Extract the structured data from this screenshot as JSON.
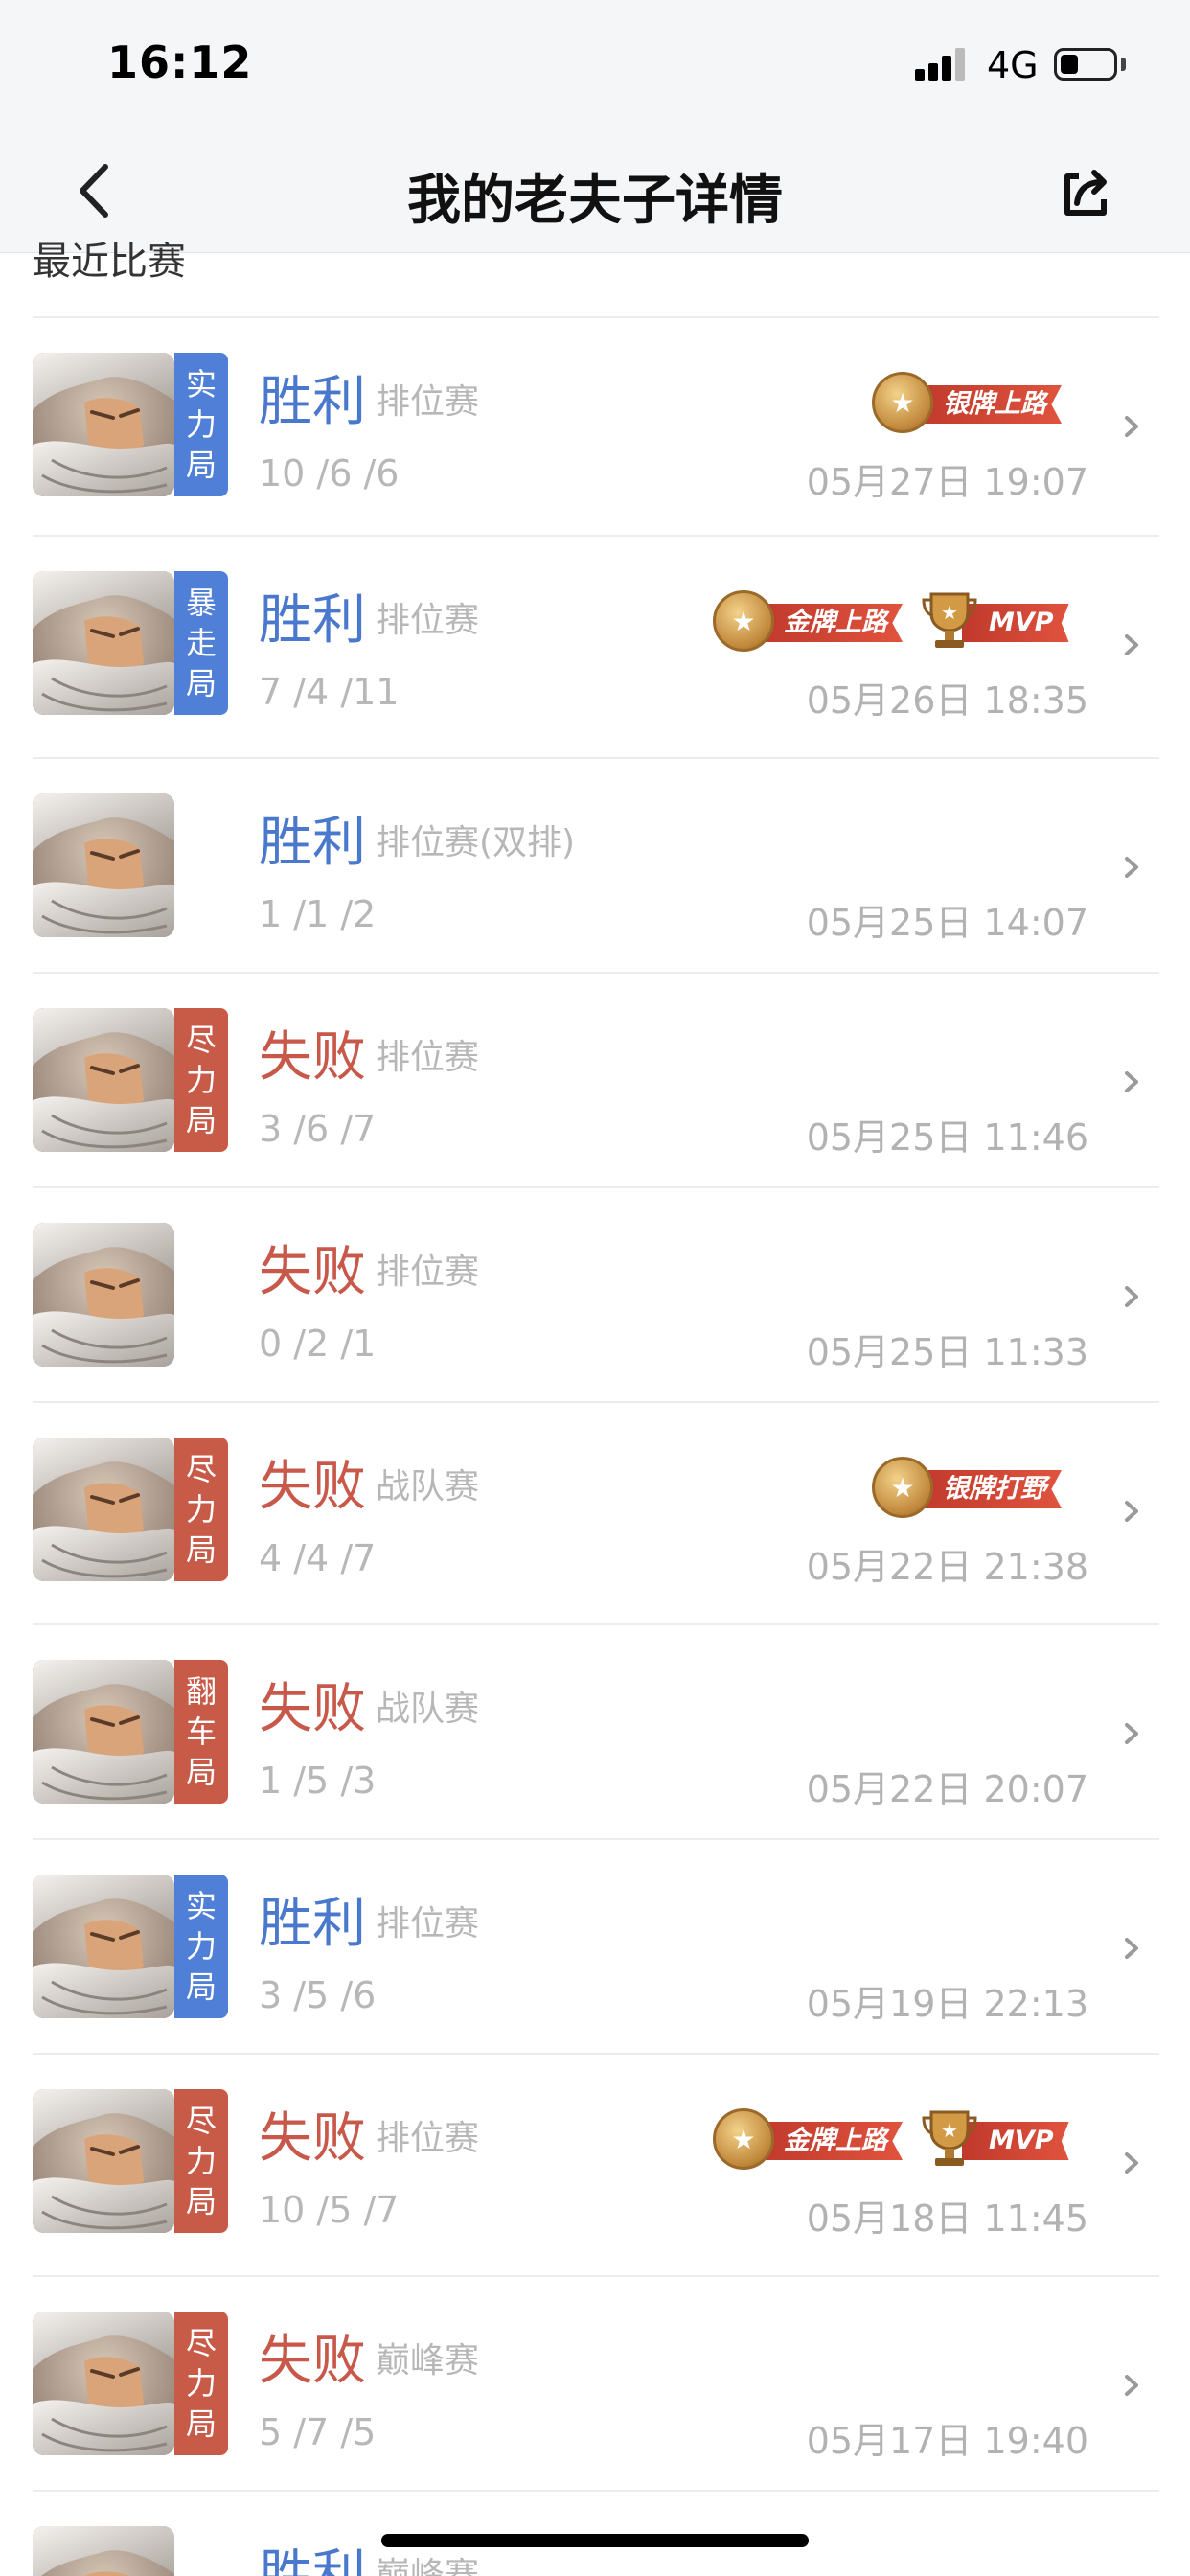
{
  "status_bar": {
    "time": "16:12",
    "network": "4G"
  },
  "nav": {
    "title": "我的老夫子详情"
  },
  "section": {
    "title": "最近比赛"
  },
  "colors": {
    "win": "#4a78cc",
    "lose": "#c8584a",
    "tag_blue": "#4f7fd6",
    "tag_red": "#c85a48",
    "muted": "#b7b7b7"
  },
  "matches": [
    {
      "tag": [
        "实",
        "力",
        "局"
      ],
      "tag_color": "blue",
      "result": "胜利",
      "outcome": "win",
      "mode": "排位赛",
      "kda": "10 /6 /6",
      "date": "05月27日 19:07",
      "badges": [
        {
          "type": "medal",
          "label": "银牌上路"
        }
      ]
    },
    {
      "tag": [
        "暴",
        "走",
        "局"
      ],
      "tag_color": "blue",
      "result": "胜利",
      "outcome": "win",
      "mode": "排位赛",
      "kda": "7 /4 /11",
      "date": "05月26日 18:35",
      "badges": [
        {
          "type": "medal",
          "label": "金牌上路"
        },
        {
          "type": "cup",
          "label": "MVP"
        }
      ]
    },
    {
      "tag": [],
      "tag_color": "",
      "result": "胜利",
      "outcome": "win",
      "mode": "排位赛(双排)",
      "kda": "1 /1 /2",
      "date": "05月25日 14:07",
      "badges": []
    },
    {
      "tag": [
        "尽",
        "力",
        "局"
      ],
      "tag_color": "red",
      "result": "失败",
      "outcome": "lose",
      "mode": "排位赛",
      "kda": "3 /6 /7",
      "date": "05月25日 11:46",
      "badges": []
    },
    {
      "tag": [],
      "tag_color": "",
      "result": "失败",
      "outcome": "lose",
      "mode": "排位赛",
      "kda": "0 /2 /1",
      "date": "05月25日 11:33",
      "badges": []
    },
    {
      "tag": [
        "尽",
        "力",
        "局"
      ],
      "tag_color": "red",
      "result": "失败",
      "outcome": "lose",
      "mode": "战队赛",
      "kda": "4 /4 /7",
      "date": "05月22日 21:38",
      "badges": [
        {
          "type": "medal",
          "label": "银牌打野"
        }
      ]
    },
    {
      "tag": [
        "翻",
        "车",
        "局"
      ],
      "tag_color": "red",
      "result": "失败",
      "outcome": "lose",
      "mode": "战队赛",
      "kda": "1 /5 /3",
      "date": "05月22日 20:07",
      "badges": []
    },
    {
      "tag": [
        "实",
        "力",
        "局"
      ],
      "tag_color": "blue",
      "result": "胜利",
      "outcome": "win",
      "mode": "排位赛",
      "kda": "3 /5 /6",
      "date": "05月19日 22:13",
      "badges": []
    },
    {
      "tag": [
        "尽",
        "力",
        "局"
      ],
      "tag_color": "red",
      "result": "失败",
      "outcome": "lose",
      "mode": "排位赛",
      "kda": "10 /5 /7",
      "date": "05月18日 11:45",
      "badges": [
        {
          "type": "medal",
          "label": "金牌上路"
        },
        {
          "type": "cup",
          "label": "MVP"
        }
      ]
    },
    {
      "tag": [
        "尽",
        "力",
        "局"
      ],
      "tag_color": "red",
      "result": "失败",
      "outcome": "lose",
      "mode": "巅峰赛",
      "kda": "5 /7 /5",
      "date": "05月17日 19:40",
      "badges": []
    },
    {
      "tag": [],
      "tag_color": "",
      "result": "胜利",
      "outcome": "win",
      "mode": "巅峰赛",
      "kda": "",
      "date": "",
      "badges": []
    }
  ]
}
